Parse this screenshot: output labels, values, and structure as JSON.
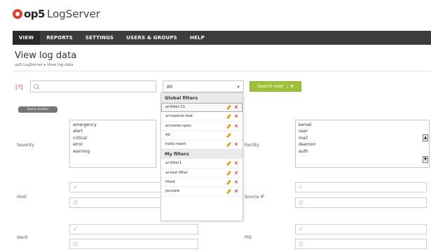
{
  "logo": {
    "brand": "op5",
    "product": "LogServer"
  },
  "nav": {
    "items": [
      "VIEW",
      "REPORTS",
      "SETTINGS",
      "USERS & GROUPS",
      "HELP"
    ]
  },
  "page": {
    "title": "View log data",
    "crumb_root": "op5 LogServer",
    "crumb_current": "View log data"
  },
  "search": {
    "placeholder": "",
    "bracket": "[?]"
  },
  "filter_select": {
    "value": "All"
  },
  "search_button": {
    "label": "Search now!"
  },
  "query_builder": {
    "label": "Query builder"
  },
  "severity": {
    "label": "Severity",
    "options": [
      "emergency",
      "alert",
      "critical",
      "error",
      "warning"
    ]
  },
  "facility": {
    "label": "Facility",
    "options": [
      "kernel",
      "user",
      "mail",
      "daemon",
      "auth"
    ]
  },
  "host": {
    "label": "Host",
    "include_symbol": "✓",
    "exclude_symbol": "∅"
  },
  "source_ip": {
    "label": "Source IP"
  },
  "ident": {
    "label": "Ident"
  },
  "pid": {
    "label": "PID"
  },
  "dropdown": {
    "global_heading": "Global filters",
    "global_items": [
      "al-filter-11",
      "al-reports-test",
      "al-meter-ipen",
      "All",
      "hello-nexti"
    ],
    "my_heading": "My filters",
    "my_items": [
      "al-filter1",
      "al-test filter",
      "ittest",
      "jacoww"
    ]
  },
  "colors": {
    "accent": "#e0402a",
    "button": "#9fc13a",
    "nav": "#3d3d3d"
  }
}
